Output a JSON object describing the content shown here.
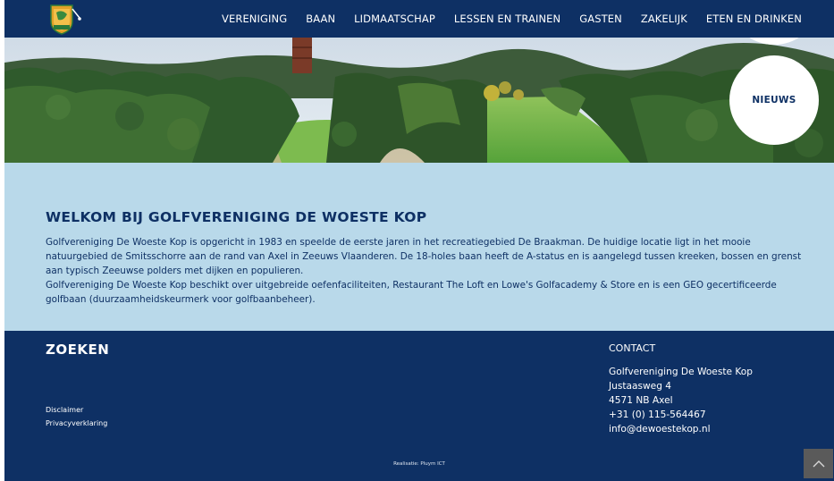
{
  "nav": {
    "items": [
      "VERENIGING",
      "BAAN",
      "LIDMAATSCHAP",
      "LESSEN EN TRAINEN",
      "GASTEN",
      "ZAKELIJK",
      "ETEN EN DRINKEN"
    ]
  },
  "hero": {
    "nieuws_label": "NIEUWS"
  },
  "welcome": {
    "title": "WELKOM BIJ GOLFVERENIGING DE WOESTE KOP",
    "paragraph1": "Golfvereniging De Woeste Kop is opgericht in 1983 en speelde de eerste jaren in het recreatiegebied De Braakman. De huidige locatie ligt in het mooie natuurgebied de Smitsschorre aan de rand van Axel in Zeeuws Vlaanderen. De 18-holes baan heeft de A-status en is aangelegd tussen kreeken, bossen en grenst aan typisch Zeeuwse polders met dijken en populieren.",
    "paragraph2": "Golfvereniging De Woeste Kop beschikt over uitgebreide oefenfaciliteiten, Restaurant The Loft en Lowe's Golfacademy & Store en is een GEO gecertificeerde golfbaan (duurzaamheidskeurmerk voor golfbaanbeheer)."
  },
  "footer": {
    "search_title": "ZOEKEN",
    "links": [
      "Disclaimer",
      "Privacyverklaring"
    ],
    "contact_title": "CONTACT",
    "contact_lines": [
      "Golfvereniging De Woeste Kop",
      "Justaasweg 4",
      "4571 NB  Axel",
      "+31 (0) 115-564467",
      "info@dewoestekop.nl"
    ],
    "credit": "Realisatie: Pluym ICT"
  },
  "colors": {
    "navy": "#0e3064",
    "light_blue": "#b9d9ea",
    "white": "#ffffff"
  }
}
